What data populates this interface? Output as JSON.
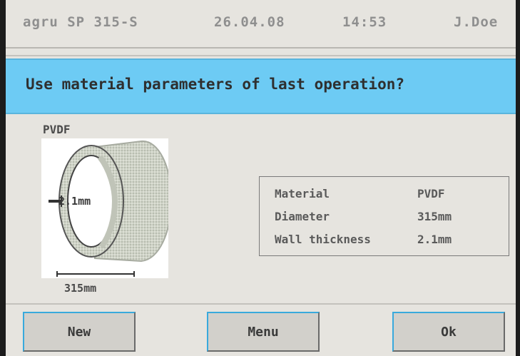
{
  "header": {
    "device": "agru SP 315-S",
    "date": "26.04.08",
    "time": "14:53",
    "user": "J.Doe"
  },
  "prompt": "Use material parameters of last operation?",
  "diagram": {
    "material": "PVDF",
    "wall_label": "2.1mm",
    "diameter_label": "315mm"
  },
  "params": [
    {
      "key": "Material",
      "value": "PVDF"
    },
    {
      "key": "Diameter",
      "value": "315mm"
    },
    {
      "key": "Wall thickness",
      "value": "2.1mm"
    }
  ],
  "buttons": {
    "new": "New",
    "menu": "Menu",
    "ok": "Ok"
  },
  "colors": {
    "banner": "#6dcbf4",
    "button_highlight": "#39a9dc",
    "background": "#e6e4df"
  },
  "icons": {
    "pipe": "pipe-cross-section-icon"
  }
}
